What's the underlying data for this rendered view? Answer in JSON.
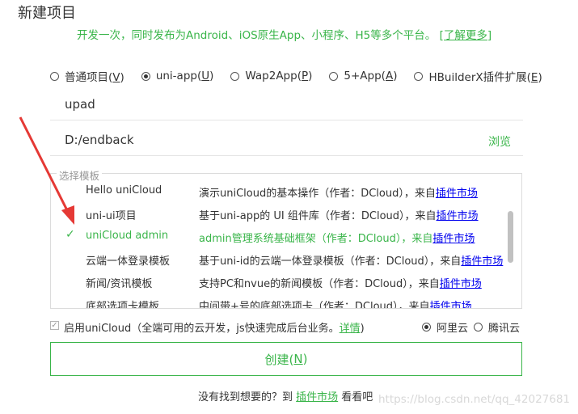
{
  "dialog": {
    "title": "新建项目",
    "subtitle_text": "开发一次，同时发布为Android、iOS原生App、小程序、H5等多个平台。",
    "subtitle_link": "[了解更多]"
  },
  "project_types": [
    {
      "label": "普通项目(",
      "key": "V",
      "suffix": ")",
      "selected": false
    },
    {
      "label": "uni-app(",
      "key": "U",
      "suffix": ")",
      "selected": true
    },
    {
      "label": "Wap2App(",
      "key": "P",
      "suffix": ")",
      "selected": false
    },
    {
      "label": "5+App(",
      "key": "A",
      "suffix": ")",
      "selected": false
    },
    {
      "label": "HBuilderX插件扩展(",
      "key": "E",
      "suffix": ")",
      "selected": false
    }
  ],
  "project_name": "upad",
  "project_path": "D:/endback",
  "browse_label": "浏览",
  "templates": {
    "legend": "选择模板",
    "source_prefix": "来自",
    "source_link": "插件市场",
    "items": [
      {
        "name": "Hello uniCloud",
        "desc": "演示uniCloud的基本操作（作者：DCloud），"
      },
      {
        "name": "uni-ui项目",
        "desc": "基于uni-app的 UI 组件库（作者：DCloud），"
      },
      {
        "name": "uniCloud admin",
        "desc": "admin管理系统基础框架（作者：DCloud），",
        "selected": true
      },
      {
        "name": "云端一体登录模板",
        "desc": "基于uni-id的云端一体登录模板（作者：DCloud），"
      },
      {
        "name": "新闻/资讯模板",
        "desc": "支持PC和nvue的新闻模板（作者：DCloud），"
      },
      {
        "name": "底部选项卡模板",
        "desc": "中间带+号的底部选项卡（作者：DCloud），"
      }
    ]
  },
  "unicloud": {
    "checked": true,
    "label": "启用uniCloud（全端可用的云开发，js快速完成后台业务。",
    "detail_link": "详情",
    "close_paren": ")",
    "providers": [
      {
        "label": "阿里云",
        "selected": true
      },
      {
        "label": "腾讯云",
        "selected": false
      }
    ]
  },
  "create_button": {
    "label": "创建(",
    "key": "N",
    "suffix": ")"
  },
  "footer": {
    "prefix": "没有找到想要的？到 ",
    "link": "插件市场",
    "suffix": " 看看吧"
  },
  "watermark": "https://blog.csdn.net/qq_42027681",
  "colors": {
    "accent": "#3ab54a",
    "link": "#0000ee",
    "annotation_arrow": "#e53935"
  }
}
